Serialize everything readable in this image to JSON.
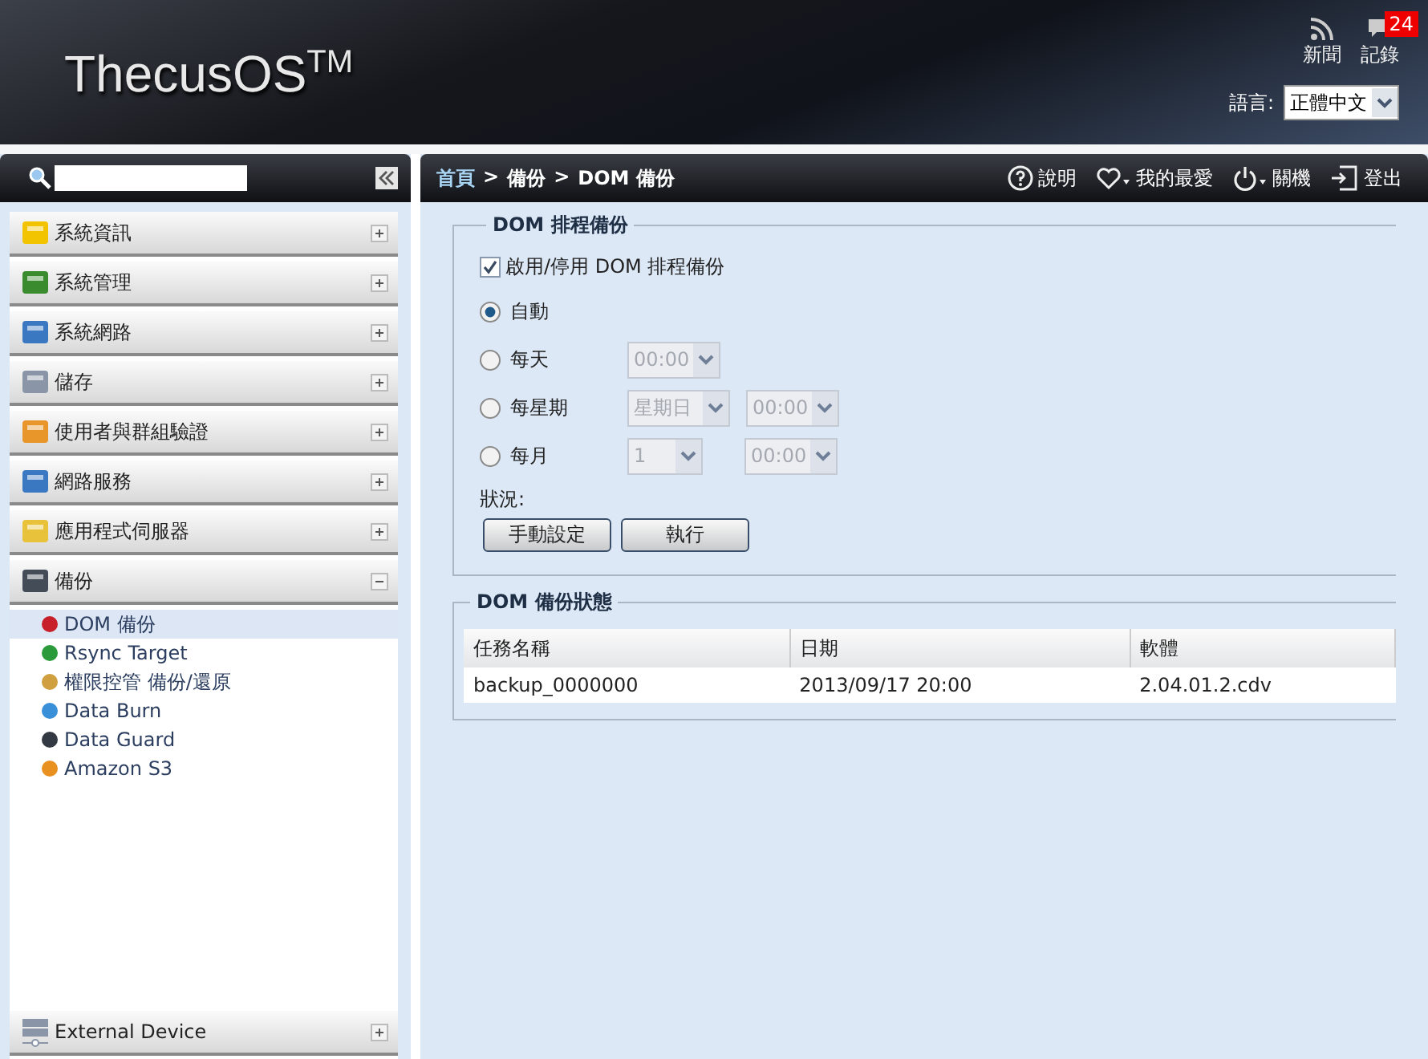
{
  "header": {
    "logo": "ThecusOS",
    "logo_mark": "TM",
    "news": "新聞",
    "log": "記錄",
    "badge": "24",
    "language_label": "語言:",
    "language": "正體中文"
  },
  "sidebar": {
    "items": [
      {
        "label": "系統資訊",
        "expanded": false
      },
      {
        "label": "系統管理",
        "expanded": false
      },
      {
        "label": "系統網路",
        "expanded": false
      },
      {
        "label": "儲存",
        "expanded": false
      },
      {
        "label": "使用者與群組驗證",
        "expanded": false
      },
      {
        "label": "網路服務",
        "expanded": false
      },
      {
        "label": "應用程式伺服器",
        "expanded": false
      },
      {
        "label": "備份",
        "expanded": true,
        "children": [
          {
            "label": "DOM 備份",
            "selected": true
          },
          {
            "label": "Rsync Target",
            "selected": false
          },
          {
            "label": "權限控管 備份/還原",
            "selected": false
          },
          {
            "label": "Data Burn",
            "selected": false
          },
          {
            "label": "Data Guard",
            "selected": false
          },
          {
            "label": "Amazon S3",
            "selected": false
          }
        ]
      }
    ],
    "bottom_item": {
      "label": "External Device",
      "expanded": false
    }
  },
  "breadcrumb": {
    "items": [
      "首頁",
      "備份",
      "DOM 備份"
    ],
    "separator": ">"
  },
  "actions": [
    "說明",
    "我的最愛",
    "關機",
    "登出"
  ],
  "schedule": {
    "title": "DOM 排程備份",
    "enable": {
      "label": "啟用/停用 DOM 排程備份",
      "checked": true
    },
    "options": [
      {
        "label": "自動",
        "selected": true
      },
      {
        "label": "每天",
        "selected": false,
        "selects": [
          {
            "value": "00:00",
            "disabled": true
          }
        ]
      },
      {
        "label": "每星期",
        "selected": false,
        "selects": [
          {
            "value": "星期日",
            "disabled": true
          },
          {
            "value": "00:00",
            "disabled": true
          }
        ]
      },
      {
        "label": "每月",
        "selected": false,
        "selects": [
          {
            "value": "1",
            "disabled": true
          },
          {
            "value": "00:00",
            "disabled": true
          }
        ]
      }
    ],
    "status_label": "狀況:",
    "buttons": [
      "手動設定",
      "執行"
    ]
  },
  "status": {
    "title": "DOM 備份狀態",
    "columns": [
      "任務名稱",
      "日期",
      "軟體"
    ],
    "rows": [
      [
        "backup_0000000",
        "2013/09/17 20:00",
        "2.04.01.2.cdv"
      ]
    ]
  }
}
